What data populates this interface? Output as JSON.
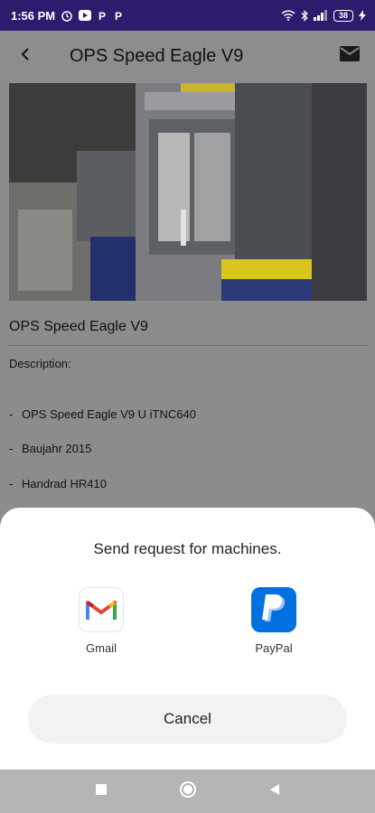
{
  "status_bar": {
    "time": "1:56 PM",
    "battery_level": "38",
    "icons": [
      "alarm-icon",
      "play-icon",
      "paypal-icon",
      "paypal-icon",
      "wifi-icon",
      "bluetooth-icon",
      "signal-icon",
      "battery-icon",
      "charging-icon"
    ]
  },
  "header": {
    "title": "OPS Speed Eagle V9",
    "back_icon": "back-arrow-icon",
    "mail_icon": "mail-icon"
  },
  "details": {
    "name": "OPS Speed Eagle V9",
    "description_label": "Description:",
    "items": [
      "OPS Speed Eagle V9 U iTNC640",
      "Baujahr 2015",
      "Handrad HR410"
    ]
  },
  "share_sheet": {
    "title": "Send request for machines.",
    "targets": [
      {
        "label": "Gmail",
        "icon": "gmail-icon"
      },
      {
        "label": "PayPal",
        "icon": "paypal-icon"
      }
    ],
    "cancel_label": "Cancel"
  },
  "colors": {
    "status_bar": "#2f1b6e",
    "paypal_blue": "#0070e0",
    "gmail_red": "#ea4335"
  }
}
